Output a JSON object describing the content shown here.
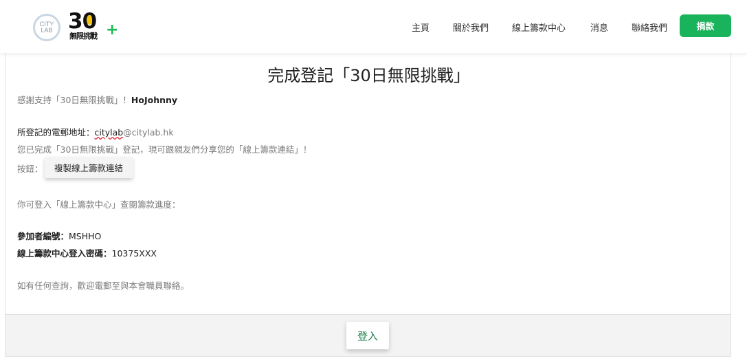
{
  "header": {
    "logo_city": "CITY LAB",
    "logo_30_num": "30",
    "logo_30_sub": "無限挑戰",
    "nav": [
      "主頁",
      "關於我們",
      "線上籌款中心",
      "消息",
      "聯絡我們"
    ],
    "donate_label": "捐款",
    "accent_color": "#18b35a"
  },
  "main": {
    "title": "完成登記「30日無限挑戰」",
    "thanks_prefix": "感謝支持「30日無限挑戰」！",
    "thanks_name": "HoJohnny",
    "email_label": "所登記的電郵地址：",
    "email_user": "citylab",
    "email_domain": "@citylab.hk",
    "share_text": "您已完成「30日無限挑戰」登記，現可跟親友們分享您的「線上籌款連結」！",
    "button_prefix": "按鈕：",
    "copy_button": "複製線上籌款連結",
    "login_hint": "你可登入「線上籌款中心」查閱籌款進度：",
    "participant_label": "參加者編號：",
    "participant_id": "MSHHO",
    "password_label": "線上籌款中心登入密碼：",
    "password_value": "10375XXX",
    "contact_text": "如有任何查詢，歡迎電郵至與本會職員聯絡。"
  },
  "footer": {
    "login_button": "登入"
  }
}
